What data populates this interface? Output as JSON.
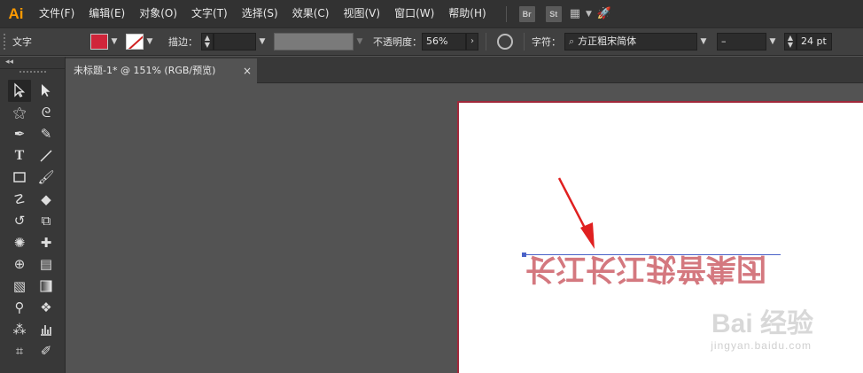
{
  "menubar": {
    "logo": "Ai",
    "items": [
      "文件(F)",
      "编辑(E)",
      "对象(O)",
      "文字(T)",
      "选择(S)",
      "效果(C)",
      "视图(V)",
      "窗口(W)",
      "帮助(H)"
    ],
    "apps": [
      "Br",
      "St"
    ]
  },
  "controlbar": {
    "tool_label": "文字",
    "stroke_label": "描边：",
    "opacity_label": "不透明度：",
    "opacity_value": "56%",
    "char_label": "字符：",
    "font_name": "方正粗宋简体",
    "font_style": "–",
    "font_size": "24 pt",
    "fill_color": "#d0253a"
  },
  "document": {
    "tab_title": "未标题-1* @ 151% (RGB/预览)",
    "tab_close": "×"
  },
  "artboard": {
    "text": "长江长江我普集团",
    "text_color": "#d4787f"
  },
  "watermark": {
    "brand": "Bai 经验",
    "url": "jingyan.baidu.com"
  }
}
